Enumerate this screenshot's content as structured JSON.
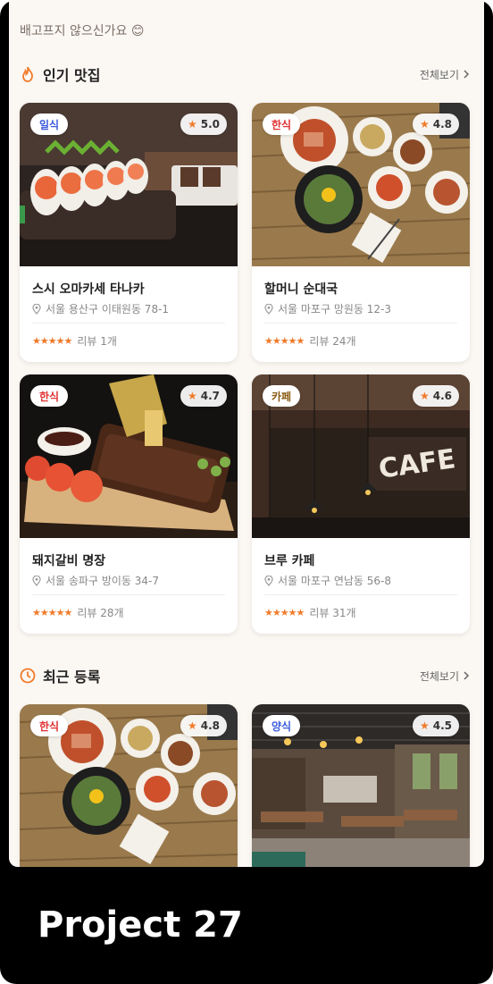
{
  "greeting": "배고프지 않으신가요 😊",
  "sections": {
    "popular": {
      "title": "인기 맛집",
      "see_all": "전체보기",
      "icon": "flame-icon"
    },
    "recent": {
      "title": "최근 등록",
      "see_all": "전체보기",
      "icon": "clock-icon"
    }
  },
  "cards": [
    {
      "category": "일식",
      "rating": "5.0",
      "name": "스시 오마카세 타나카",
      "address": "서울 용산구 이태원동 78-1",
      "stars": "★★★★★",
      "reviews": "리뷰 1개"
    },
    {
      "category": "한식",
      "rating": "4.8",
      "name": "할머니 순대국",
      "address": "서울 마포구 망원동 12-3",
      "stars": "★★★★★",
      "reviews": "리뷰 24개"
    },
    {
      "category": "한식",
      "rating": "4.7",
      "name": "돼지갈비 명장",
      "address": "서울 송파구 방이동 34-7",
      "stars": "★★★★★",
      "reviews": "리뷰 28개"
    },
    {
      "category": "카페",
      "rating": "4.6",
      "name": "브루 카페",
      "address": "서울 마포구 연남동 56-8",
      "stars": "★★★★★",
      "reviews": "리뷰 31개"
    },
    {
      "category": "한식",
      "rating": "4.8"
    },
    {
      "category": "양식",
      "rating": "4.5"
    }
  ],
  "colors": {
    "accent": "#f07b2b",
    "background": "#fbf7f3",
    "japanese_badge": "#3b5bdb",
    "korean_badge": "#e03131",
    "cafe_badge": "#8a5a12",
    "western_badge": "#3b5bdb"
  },
  "caption": "Project 27"
}
